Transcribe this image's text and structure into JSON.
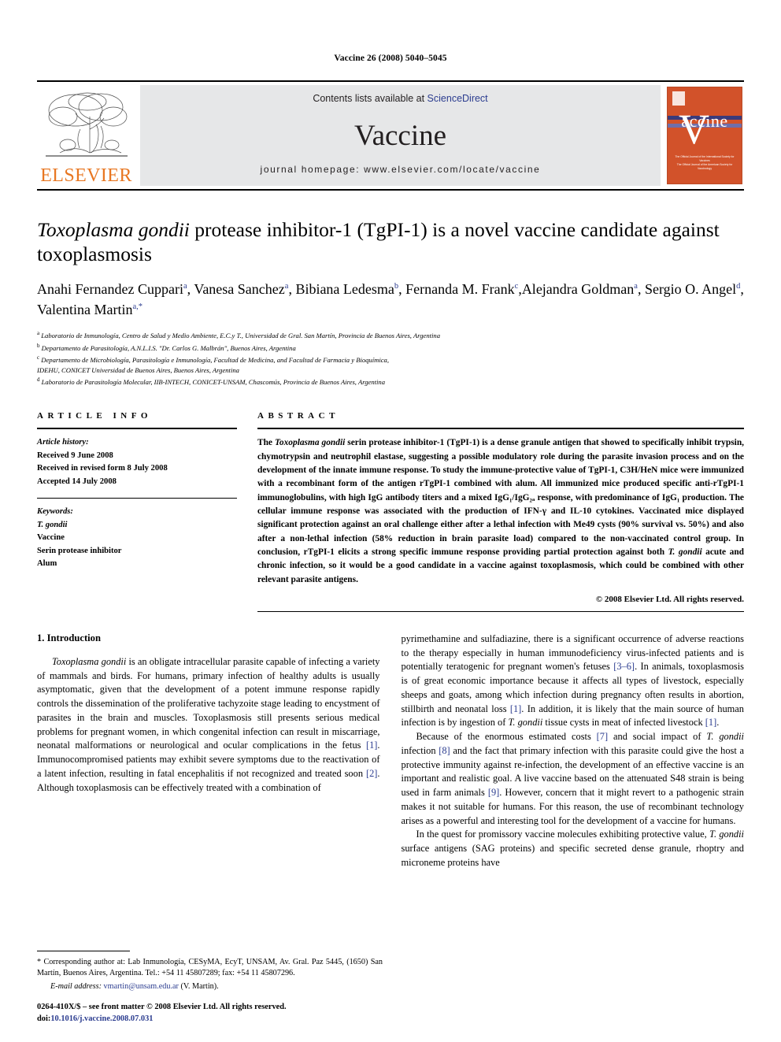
{
  "running_head": "Vaccine 26 (2008) 5040–5045",
  "banner": {
    "publisher_name": "ELSEVIER",
    "contents_prefix": "Contents lists available at ",
    "sciencedirect": "ScienceDirect",
    "journal_name": "Vaccine",
    "homepage": "journal homepage: www.elsevier.com/locate/vaccine",
    "cover": {
      "title": "accine",
      "big_letter": "V",
      "footer_line1": "The Official Journal of the International Society for Vaccines",
      "footer_line2": "The Official Journal of the American Society for Vaccinology"
    },
    "colors": {
      "banner_bg": "#e6e7e8",
      "link_blue": "#2b3c8f",
      "elsevier_orange": "#E87722",
      "cover_orange": "#d2522a"
    }
  },
  "article": {
    "title_italic": "Toxoplasma gondii",
    "title_rest": " protease inhibitor-1 (TgPI-1) is a novel vaccine candidate against toxoplasmosis",
    "authors": [
      {
        "name": "Anahi Fernandez Cuppari",
        "sup": "a",
        "sep": ", "
      },
      {
        "name": "Vanesa Sanchez",
        "sup": "a",
        "sep": ", "
      },
      {
        "name": "Bibiana Ledesma",
        "sup": "b",
        "sep": ", "
      },
      {
        "name": "Fernanda M. Frank",
        "sup": "c",
        "sep": ","
      },
      {
        "name": "Alejandra Goldman",
        "sup": "a",
        "sep": ", "
      },
      {
        "name": "Sergio O. Angel",
        "sup": "d",
        "sep": ", "
      },
      {
        "name": "Valentina Martin",
        "sup": "a,*",
        "sep": ""
      }
    ],
    "affiliations": [
      {
        "mark": "a",
        "text": "Laboratorio de Inmunología, Centro de Salud y Medio Ambiente, E.C.y T., Universidad de Gral. San Martín, Provincia de Buenos Aires, Argentina"
      },
      {
        "mark": "b",
        "text": "Departamento de Parasitología, A.N.L.I.S. \"Dr. Carlos G. Malbrán\", Buenos Aires, Argentina"
      },
      {
        "mark": "c",
        "text": "Departamento de Microbiología, Parasitología e Inmunología, Facultad de Medicina, and Facultad de Farmacia y Bioquímica,"
      },
      {
        "mark": "",
        "text": "IDEHU, CONICET Universidad de Buenos Aires, Buenos Aires, Argentina"
      },
      {
        "mark": "d",
        "text": "Laboratorio de Parasitología Molecular, IIB-INTECH, CONICET-UNSAM, Chascomús, Provincia de Buenos Aires, Argentina"
      }
    ]
  },
  "article_info": {
    "label": "ARTICLE INFO",
    "history_head": "Article history:",
    "history": [
      "Received 9 June 2008",
      "Received in revised form 8 July 2008",
      "Accepted 14 July 2008"
    ],
    "keywords_head": "Keywords:",
    "keywords": [
      "T. gondii",
      "Vaccine",
      "Serin protease inhibitor",
      "Alum"
    ]
  },
  "abstract": {
    "label": "ABSTRACT",
    "text_part1": "The ",
    "species1": "Toxoplasma gondii",
    "text_part2": " serin protease inhibitor-1 (TgPI-1) is a dense granule antigen that showed to specifically inhibit trypsin, chymotrypsin and neutrophil elastase, suggesting a possible modulatory role during the parasite invasion process and on the development of the innate immune response. To study the immune-protective value of TgPI-1, C3H/HeN mice were immunized with a recombinant form of the antigen rTgPI-1 combined with alum. All immunized mice produced specific anti-rTgPI-1 immunoglobulins, with high IgG antibody titers and a mixed IgG₁/IgG₂ₐ response, with predominance of IgG₁ production. The cellular immune response was associated with the production of IFN-γ and IL-10 cytokines. Vaccinated mice displayed significant protection against an oral challenge either after a lethal infection with Me49 cysts (90% survival vs. 50%) and also after a non-lethal infection (58% reduction in brain parasite load) compared to the non-vaccinated control group. In conclusion, rTgPI-1 elicits a strong specific immune response providing partial protection against both ",
    "species2": "T. gondii",
    "text_part3": " acute and chronic infection, so it would be a good candidate in a vaccine against toxoplasmosis, which could be combined with other relevant parasite antigens.",
    "copyright": "© 2008 Elsevier Ltd. All rights reserved."
  },
  "body": {
    "section_heading": "1. Introduction",
    "left_para1_a": "",
    "left_para1_species": "Toxoplasma gondii",
    "left_para1_b": " is an obligate intracellular parasite capable of infecting a variety of mammals and birds. For humans, primary infection of healthy adults is usually asymptomatic, given that the development of a potent immune response rapidly controls the dissemination of the proliferative tachyzoite stage leading to encystment of parasites in the brain and muscles. Toxoplasmosis still presents serious medical problems for pregnant women, in which congenital infection can result in miscarriage, neonatal malformations or neurological and ocular complications in the fetus ",
    "ref1": "[1]",
    "left_para1_c": ". Immunocompromised patients may exhibit severe symptoms due to the reactivation of a latent infection, resulting in fatal encephalitis if not recognized and treated soon ",
    "ref2": "[2]",
    "left_para1_d": ". Although toxoplasmosis can be effectively treated with a combination of",
    "right_para1_a": "pyrimethamine and sulfadiazine, there is a significant occurrence of adverse reactions to the therapy especially in human immunodeficiency virus-infected patients and is potentially teratogenic for pregnant women's fetuses ",
    "ref3": "[3–6]",
    "right_para1_b": ". In animals, toxoplasmosis is of great economic importance because it affects all types of livestock, especially sheeps and goats, among which infection during pregnancy often results in abortion, stillbirth and neonatal loss ",
    "ref4": "[1]",
    "right_para1_c": ". In addition, it is likely that the main source of human infection is by ingestion of ",
    "species_r1": "T. gondii",
    "right_para1_d": " tissue cysts in meat of infected livestock ",
    "ref5": "[1]",
    "right_para1_e": ".",
    "right_para2_a": "Because of the enormous estimated costs ",
    "ref6": "[7]",
    "right_para2_b": " and social impact of ",
    "species_r2": "T. gondii",
    "right_para2_c": " infection ",
    "ref7": "[8]",
    "right_para2_d": " and the fact that primary infection with this parasite could give the host a protective immunity against re-infection, the development of an effective vaccine is an important and realistic goal. A live vaccine based on the attenuated S48 strain is being used in farm animals ",
    "ref8": "[9]",
    "right_para2_e": ". However, concern that it might revert to a pathogenic strain makes it not suitable for humans. For this reason, the use of recombinant technology arises as a powerful and interesting tool for the development of a vaccine for humans.",
    "right_para3_a": "In the quest for promissory vaccine molecules exhibiting protective value, ",
    "species_r3": "T. gondii",
    "right_para3_b": " surface antigens (SAG proteins) and specific secreted dense granule, rhoptry and microneme proteins have"
  },
  "footnotes": {
    "corresponding": "* Corresponding author at: Lab Inmunología, CESyMA, EcyT, UNSAM, Av. Gral. Paz 5445, (1650) San Martín, Buenos Aires, Argentina. Tel.: +54 11 45807289; fax: +54 11 45807296.",
    "email_label": "E-mail address:",
    "email": "vmartin@unsam.edu.ar",
    "email_suffix": " (V. Martin).",
    "issn_line": "0264-410X/$ – see front matter © 2008 Elsevier Ltd. All rights reserved.",
    "doi_prefix": "doi:",
    "doi": "10.1016/j.vaccine.2008.07.031"
  }
}
